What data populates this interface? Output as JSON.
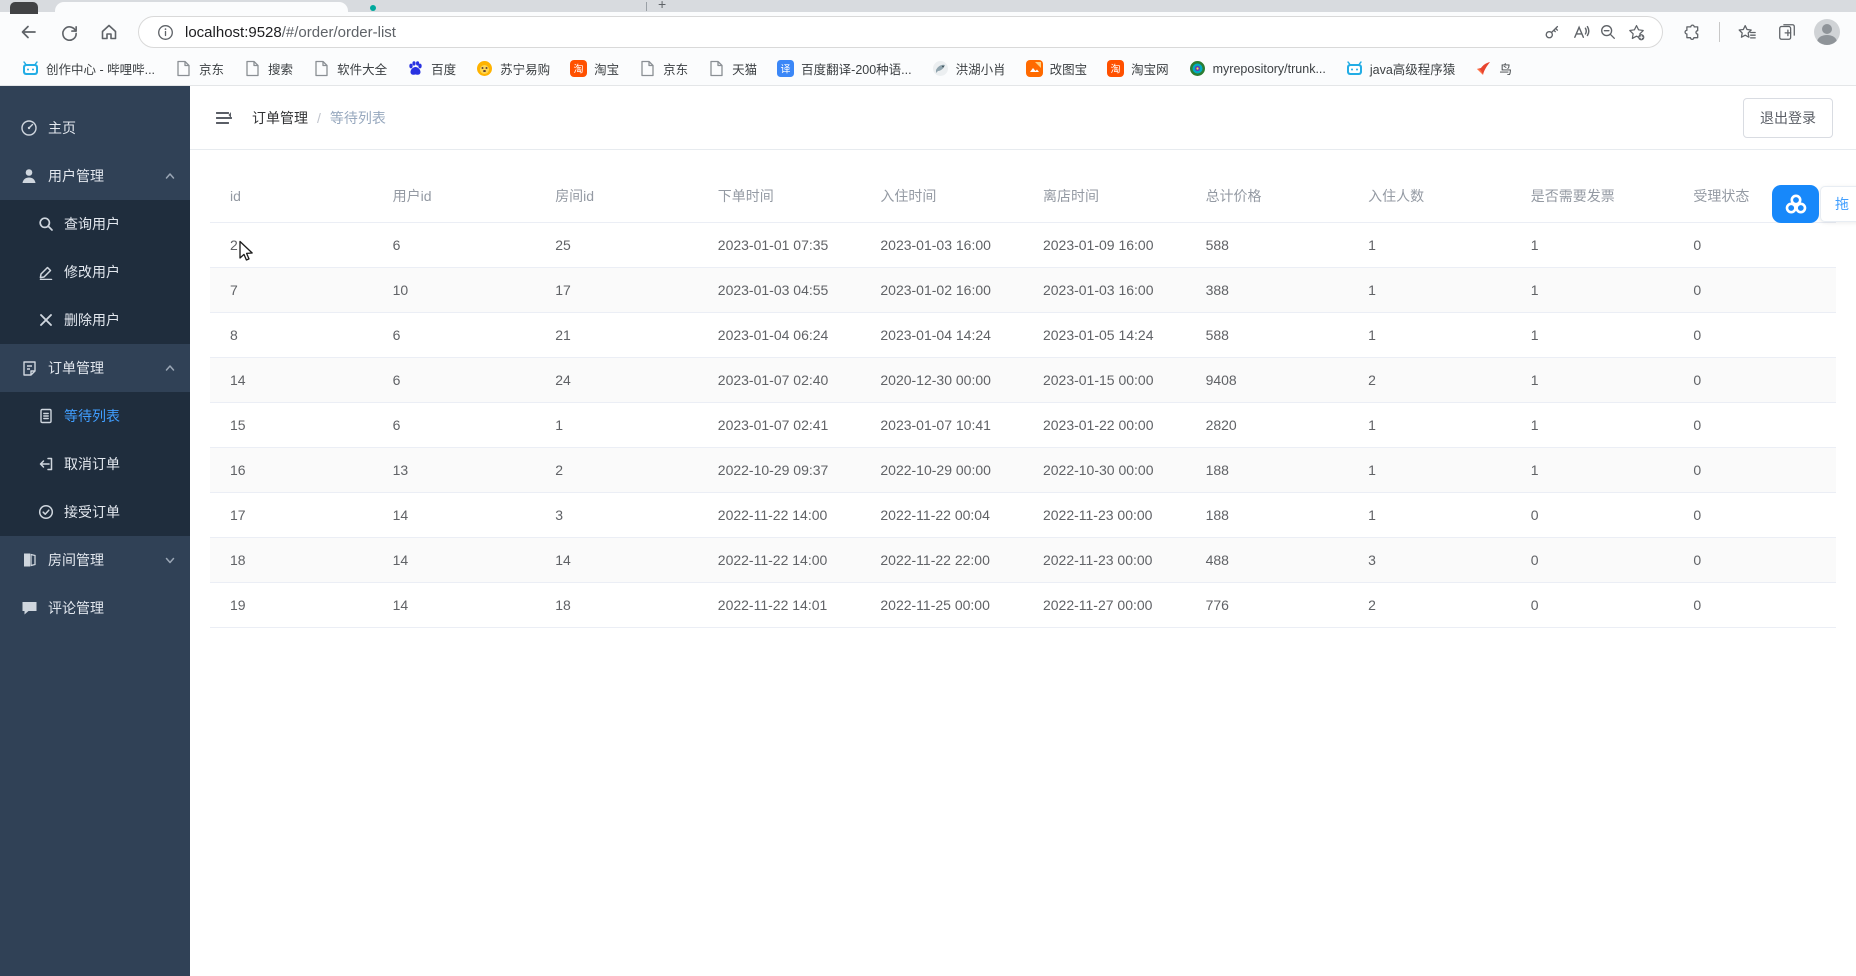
{
  "browser": {
    "url_host": "localhost:9528",
    "url_path": "/#/order/order-list",
    "toolbar_icons": [
      "back",
      "refresh",
      "home",
      "info",
      "password-key",
      "read-aloud",
      "zoom-out",
      "add-favorite",
      "extensions",
      "favorites",
      "collections",
      "profile"
    ]
  },
  "bookmarks": [
    {
      "label": "创作中心 - 哔哩哔...",
      "icon": "bilibili"
    },
    {
      "label": "京东",
      "icon": "page"
    },
    {
      "label": "搜索",
      "icon": "page"
    },
    {
      "label": "软件大全",
      "icon": "page"
    },
    {
      "label": "百度",
      "icon": "baidu-paw"
    },
    {
      "label": "苏宁易购",
      "icon": "suning-lion"
    },
    {
      "label": "淘宝",
      "icon": "taobao"
    },
    {
      "label": "京东",
      "icon": "page"
    },
    {
      "label": "天猫",
      "icon": "page"
    },
    {
      "label": "百度翻译-200种语...",
      "icon": "baidu-translate"
    },
    {
      "label": "洪湖小肖",
      "icon": "hawk"
    },
    {
      "label": "改图宝",
      "icon": "gaitubao"
    },
    {
      "label": "淘宝网",
      "icon": "taobao"
    },
    {
      "label": "myrepository/trunk...",
      "icon": "repo-swirl"
    },
    {
      "label": "java高级程序猿",
      "icon": "bilibili"
    },
    {
      "label": "鸟",
      "icon": "red-bird"
    }
  ],
  "sidebar": {
    "items": [
      {
        "label": "主页",
        "icon": "dashboard",
        "type": "root"
      },
      {
        "label": "用户管理",
        "icon": "user",
        "type": "group",
        "expanded": true,
        "children": [
          {
            "label": "查询用户",
            "icon": "search"
          },
          {
            "label": "修改用户",
            "icon": "edit"
          },
          {
            "label": "删除用户",
            "icon": "delete"
          }
        ]
      },
      {
        "label": "订单管理",
        "icon": "order",
        "type": "group",
        "expanded": true,
        "children": [
          {
            "label": "等待列表",
            "icon": "list",
            "active": true
          },
          {
            "label": "取消订单",
            "icon": "cancel"
          },
          {
            "label": "接受订单",
            "icon": "accept"
          }
        ]
      },
      {
        "label": "房间管理",
        "icon": "room",
        "type": "group",
        "expanded": false
      },
      {
        "label": "评论管理",
        "icon": "comment",
        "type": "root"
      }
    ]
  },
  "navbar": {
    "breadcrumb_parent": "订单管理",
    "breadcrumb_separator": "/",
    "breadcrumb_current": "等待列表",
    "logout_label": "退出登录"
  },
  "table": {
    "columns": [
      "id",
      "用户id",
      "房间id",
      "下单时间",
      "入住时间",
      "离店时间",
      "总计价格",
      "入住人数",
      "是否需要发票",
      "受理状态"
    ],
    "rows": [
      [
        "2",
        "6",
        "25",
        "2023-01-01 07:35",
        "2023-01-03 16:00",
        "2023-01-09 16:00",
        "588",
        "1",
        "1",
        "0"
      ],
      [
        "7",
        "10",
        "17",
        "2023-01-03 04:55",
        "2023-01-02 16:00",
        "2023-01-03 16:00",
        "388",
        "1",
        "1",
        "0"
      ],
      [
        "8",
        "6",
        "21",
        "2023-01-04 06:24",
        "2023-01-04 14:24",
        "2023-01-05 14:24",
        "588",
        "1",
        "1",
        "0"
      ],
      [
        "14",
        "6",
        "24",
        "2023-01-07 02:40",
        "2020-12-30 00:00",
        "2023-01-15 00:00",
        "9408",
        "2",
        "1",
        "0"
      ],
      [
        "15",
        "6",
        "1",
        "2023-01-07 02:41",
        "2023-01-07 10:41",
        "2023-01-22 00:00",
        "2820",
        "1",
        "1",
        "0"
      ],
      [
        "16",
        "13",
        "2",
        "2022-10-29 09:37",
        "2022-10-29 00:00",
        "2022-10-30 00:00",
        "188",
        "1",
        "1",
        "0"
      ],
      [
        "17",
        "14",
        "3",
        "2022-11-22 14:00",
        "2022-11-22 00:04",
        "2022-11-23 00:00",
        "188",
        "1",
        "0",
        "0"
      ],
      [
        "18",
        "14",
        "14",
        "2022-11-22 14:00",
        "2022-11-22 22:00",
        "2022-11-23 00:00",
        "488",
        "3",
        "0",
        "0"
      ],
      [
        "19",
        "14",
        "18",
        "2022-11-22 14:01",
        "2022-11-25 00:00",
        "2022-11-27 00:00",
        "776",
        "2",
        "0",
        "0"
      ]
    ]
  },
  "float_widget": {
    "label": "拖",
    "icon": "three-rings"
  },
  "colors": {
    "accent": "#409eff",
    "sidebar_bg": "#304156",
    "submenu_bg": "#1f2d3d",
    "widget_blue": "#1788fa",
    "table_header_text": "#949aa3",
    "table_row_text": "#606266",
    "stripe_row_bg": "#fafafa"
  }
}
